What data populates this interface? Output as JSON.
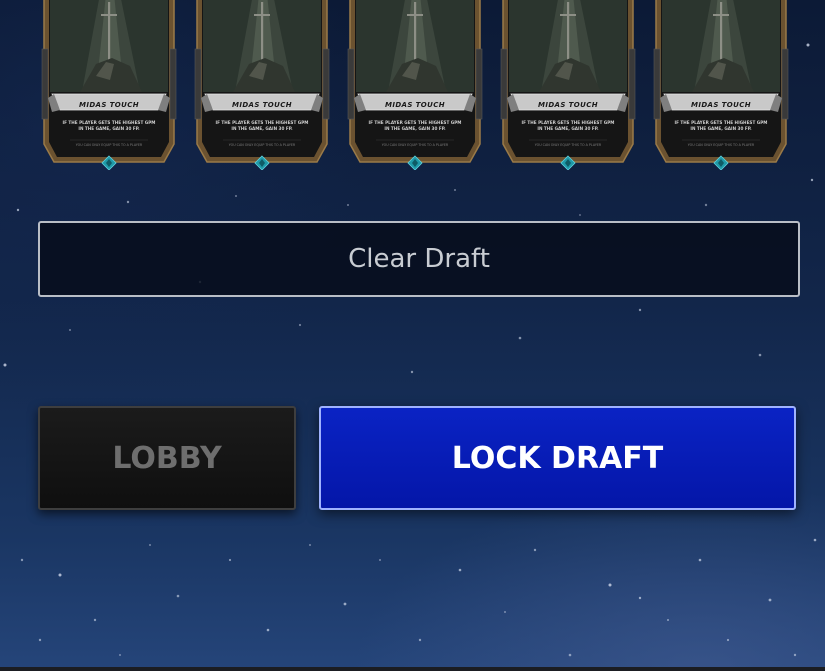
{
  "cards": [
    {
      "title": "MIDAS TOUCH",
      "description": "IF THE PLAYER GETS THE HIGHEST GPM IN THE GAME, GAIN 30 FP.",
      "footer": "YOU CAN ONLY EQUIP THIS TO A PLAYER"
    },
    {
      "title": "MIDAS TOUCH",
      "description": "IF THE PLAYER GETS THE HIGHEST GPM IN THE GAME, GAIN 30 FP.",
      "footer": "YOU CAN ONLY EQUIP THIS TO A PLAYER"
    },
    {
      "title": "MIDAS TOUCH",
      "description": "IF THE PLAYER GETS THE HIGHEST GPM IN THE GAME, GAIN 30 FP.",
      "footer": "YOU CAN ONLY EQUIP THIS TO A PLAYER"
    },
    {
      "title": "MIDAS TOUCH",
      "description": "IF THE PLAYER GETS THE HIGHEST GPM IN THE GAME, GAIN 30 FP.",
      "footer": "YOU CAN ONLY EQUIP THIS TO A PLAYER"
    },
    {
      "title": "MIDAS TOUCH",
      "description": "IF THE PLAYER GETS THE HIGHEST GPM IN THE GAME, GAIN 30 FP.",
      "footer": "YOU CAN ONLY EQUIP THIS TO A PLAYER"
    }
  ],
  "card_art_icon": "sword-in-stone-icon",
  "card_gem_icon": "diamond-gem-icon",
  "buttons": {
    "clear_draft": "Clear Draft",
    "lobby": "LOBBY",
    "lock_draft": "LOCK DRAFT"
  },
  "colors": {
    "lock_button": "#0a23c4",
    "lobby_button": "#1b1b1b",
    "background": "#12264a",
    "card_frame": "#8a6a3e",
    "gem": "#1f9aa8"
  }
}
